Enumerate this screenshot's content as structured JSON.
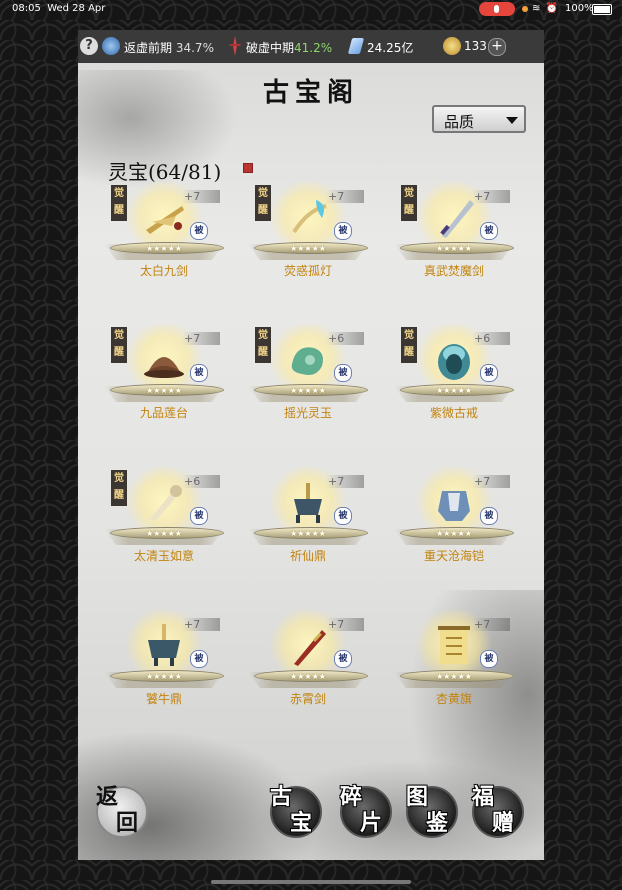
{
  "statusbar": {
    "time": "08:05",
    "date": "Wed 28 Apr",
    "battery": "100%"
  },
  "topbar": {
    "realm1_name": "返虚前期",
    "realm1_pct": "34.7%",
    "realm2_name": "破虚中期",
    "realm2_pct": "41.2%",
    "spirit_stones": "24.25亿",
    "coins": "133"
  },
  "title": "古宝阁",
  "filter": {
    "label": "品质"
  },
  "section": {
    "label": "灵宝(64/81)"
  },
  "items": [
    {
      "name": "太白九剑",
      "plus": "+7",
      "awakened": "觉醒",
      "badge": "被",
      "stars": "★★★★★",
      "art": "sword-bundle"
    },
    {
      "name": "荧惑孤灯",
      "plus": "+7",
      "awakened": "觉醒",
      "badge": "被",
      "stars": "★★★★★",
      "art": "lamp"
    },
    {
      "name": "真武焚魔剑",
      "plus": "+7",
      "awakened": "觉醒",
      "badge": "被",
      "stars": "★★★★★",
      "art": "sword"
    },
    {
      "name": "九品莲台",
      "plus": "+7",
      "awakened": "觉醒",
      "badge": "被",
      "stars": "★★★★★",
      "art": "lotus"
    },
    {
      "name": "摇光灵玉",
      "plus": "+6",
      "awakened": "觉醒",
      "badge": "被",
      "stars": "★★★★★",
      "art": "jade"
    },
    {
      "name": "紫微古戒",
      "plus": "+6",
      "awakened": "觉醒",
      "badge": "被",
      "stars": "★★★★★",
      "art": "ring"
    },
    {
      "name": "太清玉如意",
      "plus": "+6",
      "awakened": "觉醒",
      "badge": "被",
      "stars": "★★★★★",
      "art": "ruyi"
    },
    {
      "name": "祈仙鼎",
      "plus": "+7",
      "awakened": "",
      "badge": "被",
      "stars": "★★★★★",
      "art": "cauldron"
    },
    {
      "name": "重天沧海铠",
      "plus": "+7",
      "awakened": "",
      "badge": "被",
      "stars": "★★★★★",
      "art": "armor"
    },
    {
      "name": "饕牛鼎",
      "plus": "+7",
      "awakened": "",
      "badge": "被",
      "stars": "★★★★★",
      "art": "cauldron2"
    },
    {
      "name": "赤霄剑",
      "plus": "+7",
      "awakened": "",
      "badge": "被",
      "stars": "★★★★★",
      "art": "red-sword"
    },
    {
      "name": "杏黄旗",
      "plus": "+7",
      "awakened": "",
      "badge": "被",
      "stars": "★★★★★",
      "art": "banner"
    }
  ],
  "nav": {
    "back": {
      "a": "返",
      "b": "回"
    },
    "treasure": {
      "a": "古",
      "b": "宝"
    },
    "fragments": {
      "a": "碎",
      "b": "片"
    },
    "codex": {
      "a": "图",
      "b": "鉴"
    },
    "gift": {
      "a": "福",
      "b": "赠"
    }
  },
  "colors": {
    "item_name": "#c2830e",
    "realm2_pct": "#8fd46a",
    "awaken_text": "#f0d48a"
  }
}
